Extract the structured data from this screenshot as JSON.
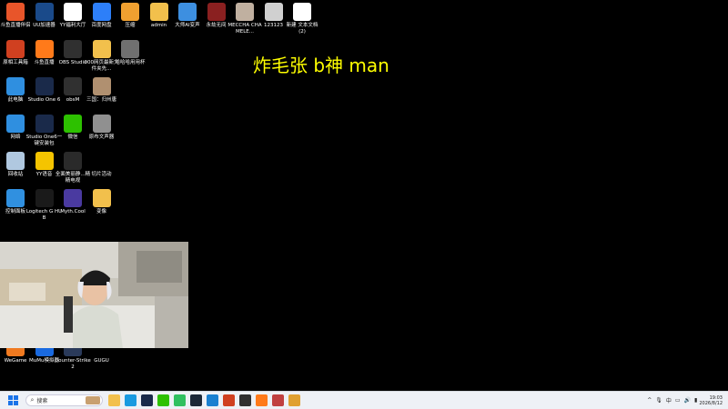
{
  "overlay_text": "炸毛张 b神 man",
  "desktop_icons": [
    {
      "label": "斗鱼直播伴侣",
      "icon": "douyu-live-icon",
      "color": "#e8552a"
    },
    {
      "label": "UU加速器",
      "icon": "uu-accelerator-icon",
      "color": "#1a4a8a"
    },
    {
      "label": "YY福利大厅",
      "icon": "document-icon",
      "color": "#ffffff"
    },
    {
      "label": "百度网盘",
      "icon": "baidu-netdisk-icon",
      "color": "#2d7ff9"
    },
    {
      "label": "压缩",
      "icon": "zip-folder-icon",
      "color": "#f0a030"
    },
    {
      "label": "admin",
      "icon": "folder-icon",
      "color": "#f2c04c"
    },
    {
      "label": "大师AI变声",
      "icon": "voice-changer-icon",
      "color": "#3d8fe0"
    },
    {
      "label": "永劫无间",
      "icon": "naraka-icon",
      "color": "#8a2020"
    },
    {
      "label": "MECCHA CHAMELE...",
      "icon": "image-file-icon",
      "color": "#c0b0a0"
    },
    {
      "label": "123123",
      "icon": "qr-image-icon",
      "color": "#d0d0d0"
    },
    {
      "label": "新建 文本文档 (2)",
      "icon": "text-file-icon",
      "color": "#ffffff"
    },
    {
      "label": "原相工具箱",
      "icon": "toolbox-icon",
      "color": "#d04020"
    },
    {
      "label": "斗鱼直播",
      "icon": "douyu-icon",
      "color": "#ff7a1a"
    },
    {
      "label": "OBS Studio",
      "icon": "obs-icon",
      "color": "#303030"
    },
    {
      "label": "000网页最新文件夹先...",
      "icon": "folder-icon",
      "color": "#f2c04c"
    },
    {
      "label": "哈哈哈用用杯",
      "icon": "shortcut-icon",
      "color": "#707070"
    },
    {
      "label": "此电脑",
      "icon": "this-pc-icon",
      "color": "#2f8fe0"
    },
    {
      "label": "Studio One 6",
      "icon": "studio-one-icon",
      "color": "#1a2a4a"
    },
    {
      "label": "obsM",
      "icon": "obs-icon",
      "color": "#303030"
    },
    {
      "label": "三国：归州唐",
      "icon": "game-icon",
      "color": "#b09070"
    },
    {
      "label": "网络",
      "icon": "network-icon",
      "color": "#2f8fe0"
    },
    {
      "label": "Studio One6一键安装包",
      "icon": "studio-one-icon",
      "color": "#1a2a4a"
    },
    {
      "label": "微信",
      "icon": "wechat-icon",
      "color": "#2dc100"
    },
    {
      "label": "原布文声器",
      "icon": "sound-card-icon",
      "color": "#909090"
    },
    {
      "label": "回收站",
      "icon": "recycle-bin-icon",
      "color": "#b0c8e0"
    },
    {
      "label": "YY语音",
      "icon": "yy-voice-icon",
      "color": "#f5c400"
    },
    {
      "label": "全面美丽静...精精电视",
      "icon": "nvidia-icon",
      "color": "#2a2a2a"
    },
    {
      "label": "切片活动",
      "icon": "blank-icon",
      "color": "#000000"
    },
    {
      "label": "控制面板",
      "icon": "control-panel-icon",
      "color": "#3090e0"
    },
    {
      "label": "Logitech G HUB",
      "icon": "logitech-icon",
      "color": "#1a1a1a"
    },
    {
      "label": "Myth.Cool",
      "icon": "myth-icon",
      "color": "#4a3aa0"
    },
    {
      "label": "变像",
      "icon": "folder-icon",
      "color": "#f2c04c"
    },
    {
      "label": "WeGame",
      "icon": "wegame-icon",
      "color": "#f07a20"
    },
    {
      "label": "MuMu模拟器",
      "icon": "mumu-icon",
      "color": "#1a6ae0"
    },
    {
      "label": "Counter-Strike 2",
      "icon": "cs2-icon",
      "color": "#2a3a5a"
    },
    {
      "label": "GUGU",
      "icon": "gugu-icon",
      "color": "#000000"
    }
  ],
  "webcam": {
    "label": "webcam-feed"
  },
  "taskbar": {
    "search_placeholder": "搜索",
    "apps": [
      {
        "icon": "file-explorer-icon",
        "color": "#f2c04c"
      },
      {
        "icon": "edge-icon",
        "color": "#1a9ae0"
      },
      {
        "icon": "studio-one-icon",
        "color": "#1a2a4a"
      },
      {
        "icon": "wechat-icon",
        "color": "#2dc100"
      },
      {
        "icon": "qq-music-icon",
        "color": "#30c060"
      },
      {
        "icon": "steam-icon",
        "color": "#1b2838"
      },
      {
        "icon": "battle-net-icon",
        "color": "#1a80d0"
      },
      {
        "icon": "toolbox-icon",
        "color": "#d04020"
      },
      {
        "icon": "obs-icon",
        "color": "#303030"
      },
      {
        "icon": "douyu-icon",
        "color": "#ff7a1a"
      },
      {
        "icon": "game-icon",
        "color": "#c04040"
      },
      {
        "icon": "gallery-icon",
        "color": "#e0a030"
      }
    ],
    "time": "19:03",
    "date": "2026/8/12"
  }
}
